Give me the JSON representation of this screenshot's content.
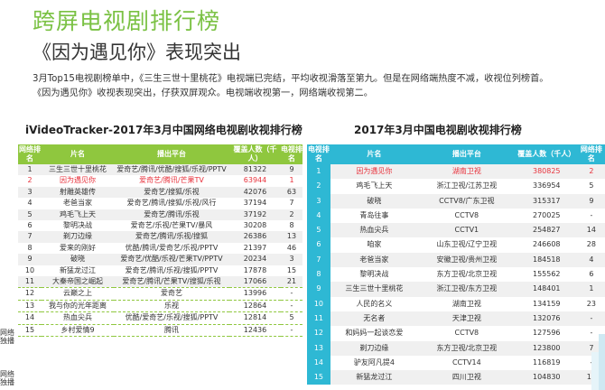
{
  "header": {
    "title": "跨屏电视剧排行榜",
    "subtitle": "《因为遇见你》表现突出",
    "desc_line1": "3月Top15电视剧榜单中，《三生三世十里桃花》电视端已完结，平均收视滑落至第九。但是在网络端热度不减，收视位列榜首。",
    "desc_line2": "《因为遇见你》收视表现突出，仔获双屏观众。电视端收视第一，网络端收视第二。"
  },
  "left_table": {
    "title": "iVideoTracker-2017年3月中国网络电视剧收视排行榜",
    "headers": [
      "网络排名",
      "片名",
      "播出平台",
      "覆盖人数（千人）",
      "电视排名"
    ],
    "rows": [
      {
        "rank": "1",
        "name": "三生三世十里桃花",
        "platform": "爱奇艺/腾讯/优酷/搜狐/乐视/PPTV",
        "reach": "81322",
        "tv_rank": "9"
      },
      {
        "rank": "2",
        "name": "因为遇见你",
        "platform": "爱奇艺/腾讯/芒果TV",
        "reach": "63944",
        "tv_rank": "1"
      },
      {
        "rank": "3",
        "name": "射雕英雄传",
        "platform": "爱奇艺/搜狐/乐视",
        "reach": "42076",
        "tv_rank": "63"
      },
      {
        "rank": "4",
        "name": "老爸当家",
        "platform": "爱奇艺/腾讯/搜狐/乐视/风行",
        "reach": "37194",
        "tv_rank": "7"
      },
      {
        "rank": "5",
        "name": "鸡毛飞上天",
        "platform": "爱奇艺/腾讯/乐视",
        "reach": "37192",
        "tv_rank": "2"
      },
      {
        "rank": "6",
        "name": "黎明决战",
        "platform": "爱奇艺/乐视/芒果TV/暴风",
        "reach": "30208",
        "tv_rank": "8"
      },
      {
        "rank": "7",
        "name": "剃刀边缘",
        "platform": "爱奇艺/腾讯/乐视/搜狐",
        "reach": "26386",
        "tv_rank": "13"
      },
      {
        "rank": "8",
        "name": "爱来的刚好",
        "platform": "优酷/腾讯/爱奇艺/乐视/PPTV",
        "reach": "21397",
        "tv_rank": "46"
      },
      {
        "rank": "9",
        "name": "破晓",
        "platform": "爱奇艺/优酷/乐视/芒果TV/PPTV",
        "reach": "20234",
        "tv_rank": "3"
      },
      {
        "rank": "10",
        "name": "新猛龙过江",
        "platform": "爱奇艺/腾讯/乐视/搜狐/PPTV",
        "reach": "17878",
        "tv_rank": "15"
      },
      {
        "rank": "11",
        "name": "大秦帝国之崛起",
        "platform": "爱奇艺/腾讯/芒果TV/搜狐/乐视",
        "reach": "17066",
        "tv_rank": "21"
      },
      {
        "rank": "12",
        "name": "云巅之上",
        "platform": "爱奇艺",
        "reach": "13996",
        "tv_rank": "-"
      },
      {
        "rank": "13",
        "name": "我与你的光年距离",
        "platform": "乐视",
        "reach": "12864",
        "tv_rank": "-"
      },
      {
        "rank": "14",
        "name": "热血尖兵",
        "platform": "优酷/爱奇艺/乐视/搜狐/PPTV",
        "reach": "12814",
        "tv_rank": "5"
      },
      {
        "rank": "15",
        "name": "乡村爱情9",
        "platform": "腾讯",
        "reach": "12436",
        "tv_rank": "-"
      }
    ],
    "side_label_1": "网络独播",
    "side_label_2": "网络独播"
  },
  "right_table": {
    "title": "2017年3月中国电视剧收视排行榜",
    "headers": [
      "电视排名",
      "片名",
      "播出平台",
      "覆盖人数（千人）",
      "网络排名"
    ],
    "rows": [
      {
        "rank": "1",
        "name": "因为遇见你",
        "platform": "湖南卫视",
        "reach": "380825",
        "net_rank": "2"
      },
      {
        "rank": "2",
        "name": "鸡毛飞上天",
        "platform": "浙江卫视/江苏卫视",
        "reach": "336954",
        "net_rank": "5"
      },
      {
        "rank": "3",
        "name": "破晓",
        "platform": "CCTV8/广东卫视",
        "reach": "315317",
        "net_rank": "9"
      },
      {
        "rank": "4",
        "name": "青岛往事",
        "platform": "CCTV8",
        "reach": "270025",
        "net_rank": "-"
      },
      {
        "rank": "5",
        "name": "热血尖兵",
        "platform": "CCTV1",
        "reach": "254827",
        "net_rank": "14"
      },
      {
        "rank": "6",
        "name": "咱家",
        "platform": "山东卫视/辽宁卫视",
        "reach": "246608",
        "net_rank": "28"
      },
      {
        "rank": "7",
        "name": "老爸当家",
        "platform": "安徽卫视/贵州卫视",
        "reach": "184518",
        "net_rank": "4"
      },
      {
        "rank": "8",
        "name": "黎明决战",
        "platform": "东方卫视/北京卫视",
        "reach": "155562",
        "net_rank": "6"
      },
      {
        "rank": "9",
        "name": "三生三世十里桃花",
        "platform": "浙江卫视/东方卫视",
        "reach": "148401",
        "net_rank": "1"
      },
      {
        "rank": "10",
        "name": "人民的名义",
        "platform": "湖南卫视",
        "reach": "134159",
        "net_rank": "23"
      },
      {
        "rank": "11",
        "name": "无名者",
        "platform": "天津卫视",
        "reach": "132076",
        "net_rank": "-"
      },
      {
        "rank": "12",
        "name": "和妈妈一起谈恋爱",
        "platform": "CCTV8",
        "reach": "127596",
        "net_rank": "-"
      },
      {
        "rank": "13",
        "name": "剃刀边缘",
        "platform": "东方卫视/北京卫视",
        "reach": "123800",
        "net_rank": "7"
      },
      {
        "rank": "14",
        "name": "驴友阿凡提4",
        "platform": "CCTV14",
        "reach": "116819",
        "net_rank": "-"
      },
      {
        "rank": "15",
        "name": "新猛龙过江",
        "platform": "四川卫视",
        "reach": "104830",
        "net_rank": "10"
      }
    ]
  },
  "colors": {
    "green": "#8fc73e",
    "title_green": "#7ac143",
    "blue": "#2eb8d4",
    "highlight_red": "#e8323c"
  }
}
